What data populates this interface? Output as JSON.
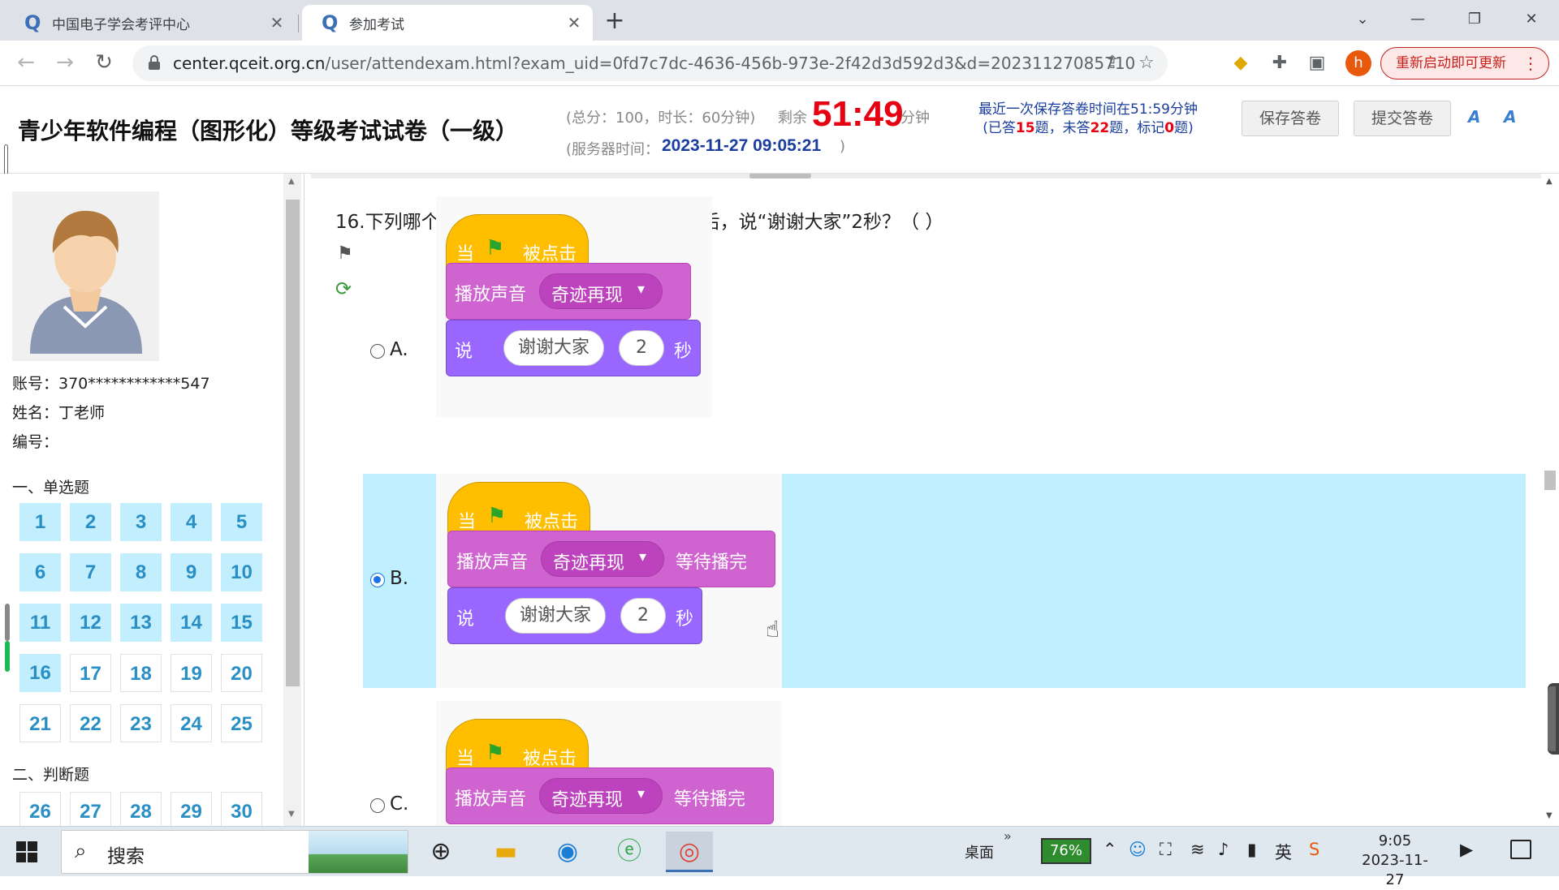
{
  "browser": {
    "tabs": [
      {
        "title": "中国电子学会考评中心",
        "close": "✕"
      },
      {
        "title": "参加考试",
        "close": "✕"
      }
    ],
    "new_tab": "+",
    "window": {
      "minimize": "—",
      "restore": "❐",
      "close": "✕",
      "tab_search": "⌄"
    },
    "url_host": "center.qceit.org.cn",
    "url_path": "/user/attendexam.html?exam_uid=0fd7c7dc-4636-456b-973e-2f42d3d592d3&d=20231127085710",
    "profile_initial": "h",
    "update_button": "重新启动即可更新",
    "update_menu": "⋮"
  },
  "exam": {
    "title": "青少年软件编程（图形化）等级考试试卷（一级）",
    "totals": "(总分：100，时长：60分钟)",
    "remaining_label": "剩余",
    "timer": "51:49",
    "minutes_label": "分钟",
    "server_label": "(服务器时间：",
    "server_time": "2023-11-27 09:05:21",
    "server_close": ")",
    "save_info_line1": "最近一次保存答卷时间在51:59分钟",
    "save_info_answered_prefix": "(已答",
    "answered": "15",
    "save_info_unanswered_prefix": "题，未答",
    "unanswered": "22",
    "save_info_marked_prefix": "题，标记",
    "marked": "0",
    "save_info_suffix": "题)",
    "save_button": "保存答卷",
    "submit_button": "提交答卷",
    "font_up": "A",
    "font_down": "A"
  },
  "user": {
    "account": "账号：370************547",
    "name": "姓名：丁老师",
    "number": "编号："
  },
  "sections": {
    "single": "一、单选题",
    "judge": "二、判断题"
  },
  "question_nav": {
    "single": [
      {
        "n": "1",
        "done": true
      },
      {
        "n": "2",
        "done": true
      },
      {
        "n": "3",
        "done": true
      },
      {
        "n": "4",
        "done": true
      },
      {
        "n": "5",
        "done": true
      },
      {
        "n": "6",
        "done": true
      },
      {
        "n": "7",
        "done": true
      },
      {
        "n": "8",
        "done": true
      },
      {
        "n": "9",
        "done": true
      },
      {
        "n": "10",
        "done": true
      },
      {
        "n": "11",
        "done": true
      },
      {
        "n": "12",
        "done": true
      },
      {
        "n": "13",
        "done": true
      },
      {
        "n": "14",
        "done": true
      },
      {
        "n": "15",
        "done": true
      },
      {
        "n": "16",
        "done": true
      },
      {
        "n": "17",
        "done": false
      },
      {
        "n": "18",
        "done": false
      },
      {
        "n": "19",
        "done": false
      },
      {
        "n": "20",
        "done": false
      },
      {
        "n": "21",
        "done": false
      },
      {
        "n": "22",
        "done": false
      },
      {
        "n": "23",
        "done": false
      },
      {
        "n": "24",
        "done": false
      },
      {
        "n": "25",
        "done": false
      }
    ],
    "judge": [
      {
        "n": "26",
        "done": false
      },
      {
        "n": "27",
        "done": false
      },
      {
        "n": "28",
        "done": false
      },
      {
        "n": "29",
        "done": false
      },
      {
        "n": "30",
        "done": false
      }
    ]
  },
  "question": {
    "text": "16.下列哪个选项可以实现，小猫唱完一首歌后，说“谢谢大家”2秒？（ ）",
    "selected": "B",
    "options": [
      {
        "label": "A.",
        "hat": [
          "当",
          "被点击"
        ],
        "sound": "播放声音",
        "sound_value": "奇迹再现",
        "dropdown": "▾",
        "wait": "",
        "say": "说",
        "say_text": "谢谢大家",
        "secs": "2",
        "secs_unit": "秒"
      },
      {
        "label": "B.",
        "hat": [
          "当",
          "被点击"
        ],
        "sound": "播放声音",
        "sound_value": "奇迹再现",
        "dropdown": "▾",
        "wait": "等待播完",
        "say": "说",
        "say_text": "谢谢大家",
        "secs": "2",
        "secs_unit": "秒"
      },
      {
        "label": "C.",
        "hat": [
          "当",
          "被点击"
        ],
        "sound": "播放声音",
        "sound_value": "奇迹再现",
        "dropdown": "▾",
        "wait": "等待播完"
      }
    ]
  },
  "taskbar": {
    "search": "搜索",
    "desktop": "桌面",
    "chevron": "»",
    "battery": "76%",
    "ime": "英",
    "time": "9:05",
    "date": "2023-11-27"
  },
  "colors": {
    "timer": "#e60012",
    "selected_row": "#c0efff",
    "answered_btn": "#c2eefd",
    "hat_block": "#ffbf00",
    "sound_block": "#cf63cf",
    "looks_block": "#9966ff"
  }
}
